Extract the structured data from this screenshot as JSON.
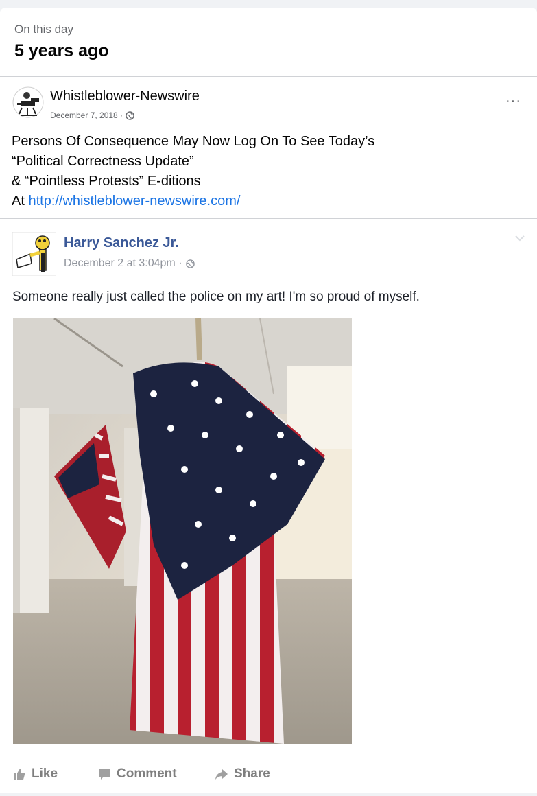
{
  "memory": {
    "label": "On this day",
    "title": "5 years ago"
  },
  "post": {
    "page_name": "Whistleblower-Newswire",
    "date": "December 7, 2018 ·",
    "more_label": "···",
    "lines": [
      "Persons Of Consequence May Now Log On To See Today’s",
      "“Political Correctness Update”",
      "& “Pointless Protests” E-ditions"
    ],
    "link_prefix": "At ",
    "link": "http://whistleblower-newswire.com/"
  },
  "shared": {
    "author": "Harry Sanchez Jr.",
    "date": "December 2 at 3:04pm ·",
    "text": "Someone really just called the police on my art! I'm so proud of myself.",
    "actions": {
      "like": "Like",
      "comment": "Comment",
      "share": "Share"
    }
  },
  "colors": {
    "link": "#1b74e4",
    "author": "#3b5998",
    "flag_red": "#b22234",
    "flag_blue": "#1c2340"
  },
  "icons": [
    "globe-icon",
    "more-options-icon",
    "chevron-down-icon",
    "thumbs-up-icon",
    "comment-icon",
    "share-arrow-icon"
  ]
}
